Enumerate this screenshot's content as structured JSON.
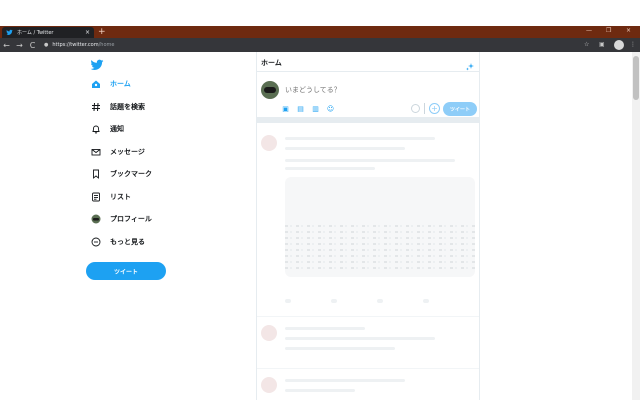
{
  "browser": {
    "tab_title": "ホーム / Twitter",
    "tab_close": "×",
    "new_tab": "+",
    "window_controls": [
      "—",
      "❐",
      "×"
    ],
    "url_host": "https://twitter.com",
    "url_path": "/home",
    "nav": [
      "←",
      "→",
      "C"
    ],
    "toolbar_icons": [
      "☆",
      "▣",
      "⋮"
    ]
  },
  "sidebar": {
    "items": [
      {
        "label": "ホーム",
        "icon": "home-icon",
        "active": true
      },
      {
        "label": "話題を検索",
        "icon": "hashtag-icon",
        "active": false
      },
      {
        "label": "通知",
        "icon": "bell-icon",
        "active": false
      },
      {
        "label": "メッセージ",
        "icon": "envelope-icon",
        "active": false
      },
      {
        "label": "ブックマーク",
        "icon": "bookmark-icon",
        "active": false
      },
      {
        "label": "リスト",
        "icon": "list-icon",
        "active": false
      },
      {
        "label": "プロフィール",
        "icon": "avatar-icon",
        "active": false
      },
      {
        "label": "もっと見る",
        "icon": "more-icon",
        "active": false
      }
    ],
    "tweet_button": "ツイート"
  },
  "main": {
    "title": "ホーム",
    "composer": {
      "placeholder": "いまどうしてる？",
      "tweet_button": "ツイート",
      "add_symbol": "+",
      "tools": [
        "▣",
        "▤",
        "▥",
        "☺"
      ]
    }
  },
  "colors": {
    "accent": "#1da1f2",
    "accent_disabled": "#8ecdf8",
    "tabstrip": "#6e2a10",
    "toolbar": "#35363a"
  }
}
